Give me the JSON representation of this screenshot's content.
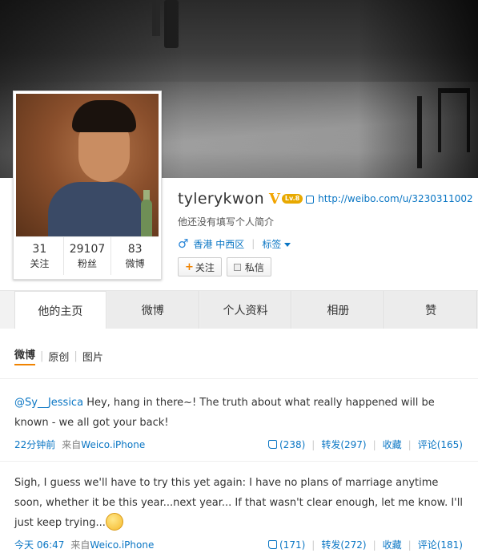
{
  "profile": {
    "username": "tylerykwon",
    "verified_icon": "V",
    "level_badge": "Lv.8",
    "url": "http://weibo.com/u/3230311002",
    "intro": "他还没有填写个人简介",
    "gender_icon": "♂",
    "location": "香港 中西区",
    "tag_label": "标签",
    "follow_label": "关注",
    "message_label": "私信",
    "stats": [
      {
        "num": "31",
        "label": "关注"
      },
      {
        "num": "29107",
        "label": "粉丝"
      },
      {
        "num": "83",
        "label": "微博"
      }
    ]
  },
  "tabs": [
    "他的主页",
    "微博",
    "个人资料",
    "相册",
    "赞"
  ],
  "subtabs": [
    "微博",
    "原创",
    "图片"
  ],
  "posts": [
    {
      "mention": "@Sy__Jessica",
      "text": " Hey, hang in there~! The truth about what really happened will be known - we all got your back!",
      "time": "22分钟前",
      "from_prefix": "来自",
      "source": "Weico.iPhone",
      "likes": "(238)",
      "repost": "转发(297)",
      "favorite": "收藏",
      "comment": "评论(165)"
    },
    {
      "text": "Sigh, I guess we'll have to try this yet again: I have no plans of marriage anytime soon, whether it be this year...next year... If that wasn't clear enough, let me know. I'll just keep trying...",
      "time": "今天 06:47",
      "from_prefix": "来自",
      "source": "Weico.iPhone",
      "likes": "(171)",
      "repost": "转发(272)",
      "favorite": "收藏",
      "comment": "评论(181)"
    }
  ],
  "colors": {
    "link": "#0a76c4",
    "accent": "#f08300",
    "verified": "#f2a400"
  }
}
